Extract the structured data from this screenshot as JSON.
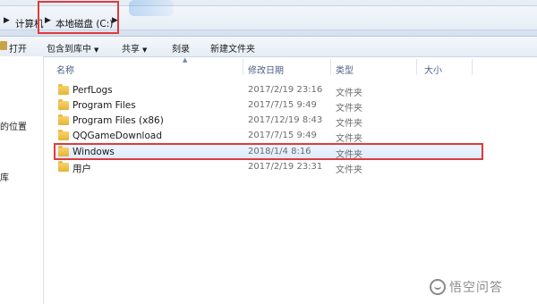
{
  "address_bar": {
    "breadcrumbs": [
      "计算机",
      "本地磁盘 (C:)"
    ]
  },
  "toolbar": {
    "open_label": "打开",
    "include_library_label": "包含到库中",
    "share_label": "共享",
    "burn_label": "刻录",
    "new_folder_label": "新建文件夹"
  },
  "nav_pane": {
    "items": [
      "的位置",
      "库"
    ]
  },
  "columns": {
    "name": "名称",
    "modified": "修改日期",
    "type": "类型",
    "size": "大小"
  },
  "files": [
    {
      "name": "PerfLogs",
      "modified": "2017/2/19 23:16",
      "type": "文件夹"
    },
    {
      "name": "Program Files",
      "modified": "2017/7/15 9:49",
      "type": "文件夹"
    },
    {
      "name": "Program Files (x86)",
      "modified": "2017/12/19 8:43",
      "type": "文件夹"
    },
    {
      "name": "QQGameDownload",
      "modified": "2017/7/15 9:49",
      "type": "文件夹"
    },
    {
      "name": "Windows",
      "modified": "2018/1/4 8:16",
      "type": "文件夹"
    },
    {
      "name": "用户",
      "modified": "2017/2/19 23:31",
      "type": "文件夹"
    }
  ],
  "selected_file_index": 4,
  "colors": {
    "annotation_highlight": "#e03b3b",
    "selection_background": "#dcebfc",
    "folder": "#e5b338"
  },
  "watermark": {
    "text": "悟空问答"
  }
}
